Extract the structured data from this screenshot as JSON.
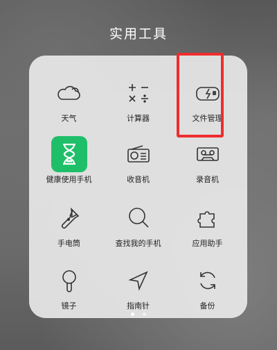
{
  "folder": {
    "title": "实用工具",
    "apps": [
      {
        "label": "天气",
        "icon": "cloud-icon"
      },
      {
        "label": "计算器",
        "icon": "calculator-icon"
      },
      {
        "label": "文件管理",
        "icon": "file-manager-icon"
      },
      {
        "label": "健康使用手机",
        "icon": "hourglass-icon"
      },
      {
        "label": "收音机",
        "icon": "radio-icon"
      },
      {
        "label": "录音机",
        "icon": "recorder-icon"
      },
      {
        "label": "手电筒",
        "icon": "flashlight-icon"
      },
      {
        "label": "查找我的手机",
        "icon": "find-phone-icon"
      },
      {
        "label": "应用助手",
        "icon": "puzzle-icon"
      },
      {
        "label": "镜子",
        "icon": "mirror-icon"
      },
      {
        "label": "指南针",
        "icon": "compass-icon"
      },
      {
        "label": "备份",
        "icon": "backup-icon"
      }
    ]
  },
  "page_indicator": {
    "current": 1,
    "total": 2
  },
  "colors": {
    "highlight": "#ee2d2d",
    "health_green": "#1fbf6a"
  }
}
